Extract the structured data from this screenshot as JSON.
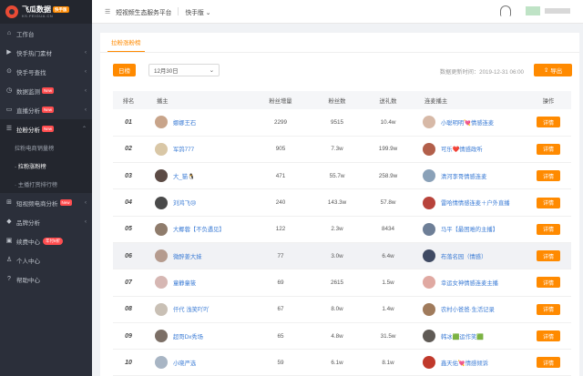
{
  "brand": {
    "name": "飞瓜数据",
    "sub": "KS.FEIGUA.CN",
    "tag": "快手版"
  },
  "topbar": {
    "platform": "短视频生态服务平台",
    "switcher": "快手版"
  },
  "sidebar": {
    "items": [
      {
        "label": "工作台",
        "icon": "home-icon",
        "badge": ""
      },
      {
        "label": "快手热门素材",
        "icon": "video-icon",
        "badge": "",
        "caret": "‹"
      },
      {
        "label": "快手号查找",
        "icon": "search-icon",
        "badge": "",
        "caret": "‹"
      },
      {
        "label": "数据监测",
        "icon": "monitor-icon",
        "badge": "New",
        "caret": "‹"
      },
      {
        "label": "直播分析",
        "icon": "live-icon",
        "badge": "New",
        "caret": "‹"
      },
      {
        "label": "拉粉分析",
        "icon": "fans-icon",
        "badge": "New",
        "caret": "⌃"
      }
    ],
    "sub_items": [
      {
        "label": "拉粉电商销量榜"
      },
      {
        "label": "· 拉粉涨粉榜"
      },
      {
        "label": "· 主播打赏排行榜"
      }
    ],
    "items2": [
      {
        "label": "短视频电商分析",
        "icon": "cart-icon",
        "badge": "New",
        "caret": "‹"
      },
      {
        "label": "品牌分析",
        "icon": "brand-icon",
        "badge": "",
        "caret": "‹"
      },
      {
        "label": "续费中心",
        "icon": "renew-icon",
        "badge": "年付6折"
      },
      {
        "label": "个人中心",
        "icon": "user-icon",
        "badge": ""
      },
      {
        "label": "帮助中心",
        "icon": "help-icon",
        "badge": ""
      }
    ]
  },
  "main": {
    "tab": "拉粉涨粉榜",
    "day_button": "日榜",
    "date_value": "12月30日",
    "update_text": "数据更新时间：2019-12-31 06:00",
    "export_button": "导出",
    "columns": [
      "排名",
      "播主",
      "粉丝增量",
      "粉丝数",
      "送礼数",
      "连麦播主",
      "操作"
    ],
    "rows": [
      {
        "rank": "01",
        "anchor": "娜娜王石",
        "av": "#c8a48a",
        "inc": "2299",
        "fans": "9515",
        "gifts": "10.4w",
        "conn": "小聪明明💘情感连麦",
        "cav": "#d7b9a7",
        "action": "详情"
      },
      {
        "rank": "02",
        "anchor": "军鸽777",
        "av": "#d9c7a6",
        "inc": "905",
        "fans": "7.3w",
        "gifts": "199.9w",
        "conn": "可乐❤️情感政听",
        "cav": "#b25f4a",
        "action": "详情"
      },
      {
        "rank": "03",
        "anchor": "大_猫🐧",
        "av": "#5c4b45",
        "inc": "471",
        "fans": "55.7w",
        "gifts": "258.9w",
        "conn": "清河李哥情感连麦",
        "cav": "#8aa1b8",
        "action": "详情"
      },
      {
        "rank": "04",
        "anchor": "刘鸿飞😢",
        "av": "#4a4a4a",
        "inc": "240",
        "fans": "143.3w",
        "gifts": "57.8w",
        "conn": "雷哈情情感连麦＋户外直播",
        "cav": "#b8433b",
        "action": "详情"
      },
      {
        "rank": "05",
        "anchor": "大椰蓉【不负遇见】",
        "av": "#8f7c6c",
        "inc": "122",
        "fans": "2.3w",
        "gifts": "8434",
        "conn": "马平【最困难的主播】",
        "cav": "#6e7f97",
        "action": "详情"
      },
      {
        "rank": "06",
        "anchor": "微醉姜大妹",
        "av": "#b59b8e",
        "inc": "77",
        "fans": "3.0w",
        "gifts": "6.4w",
        "conn": "布落名园（情感）",
        "cav": "#3f4a63",
        "action": "详情"
      },
      {
        "rank": "07",
        "anchor": "童静童筱",
        "av": "#d6b7b3",
        "inc": "69",
        "fans": "2615",
        "gifts": "1.5w",
        "conn": "幸运女神情感连麦主播",
        "cav": "#e0a9a2",
        "action": "详情"
      },
      {
        "rank": "08",
        "anchor": "仟代 浅笑吖吖",
        "av": "#c9c0b5",
        "inc": "67",
        "fans": "8.0w",
        "gifts": "1.4w",
        "conn": "农村小爸爸·生活记录",
        "cav": "#a07b5c",
        "action": "详情"
      },
      {
        "rank": "09",
        "anchor": "超哥Dx秀场",
        "av": "#7c6f66",
        "inc": "65",
        "fans": "4.8w",
        "gifts": "31.5w",
        "conn": "韩冰🟩运作笑🟩",
        "cav": "#5f5a55",
        "action": "详情"
      },
      {
        "rank": "10",
        "anchor": "小晓严选",
        "av": "#a8b5c4",
        "inc": "59",
        "fans": "6.1w",
        "gifts": "8.1w",
        "conn": "鑫天佑💘情感倾诉",
        "cav": "#c0392b",
        "action": "详情"
      }
    ]
  },
  "colors": {
    "accent": "#ff8a00",
    "link": "#3a7bd5",
    "sidebar": "#2b2f3a"
  }
}
